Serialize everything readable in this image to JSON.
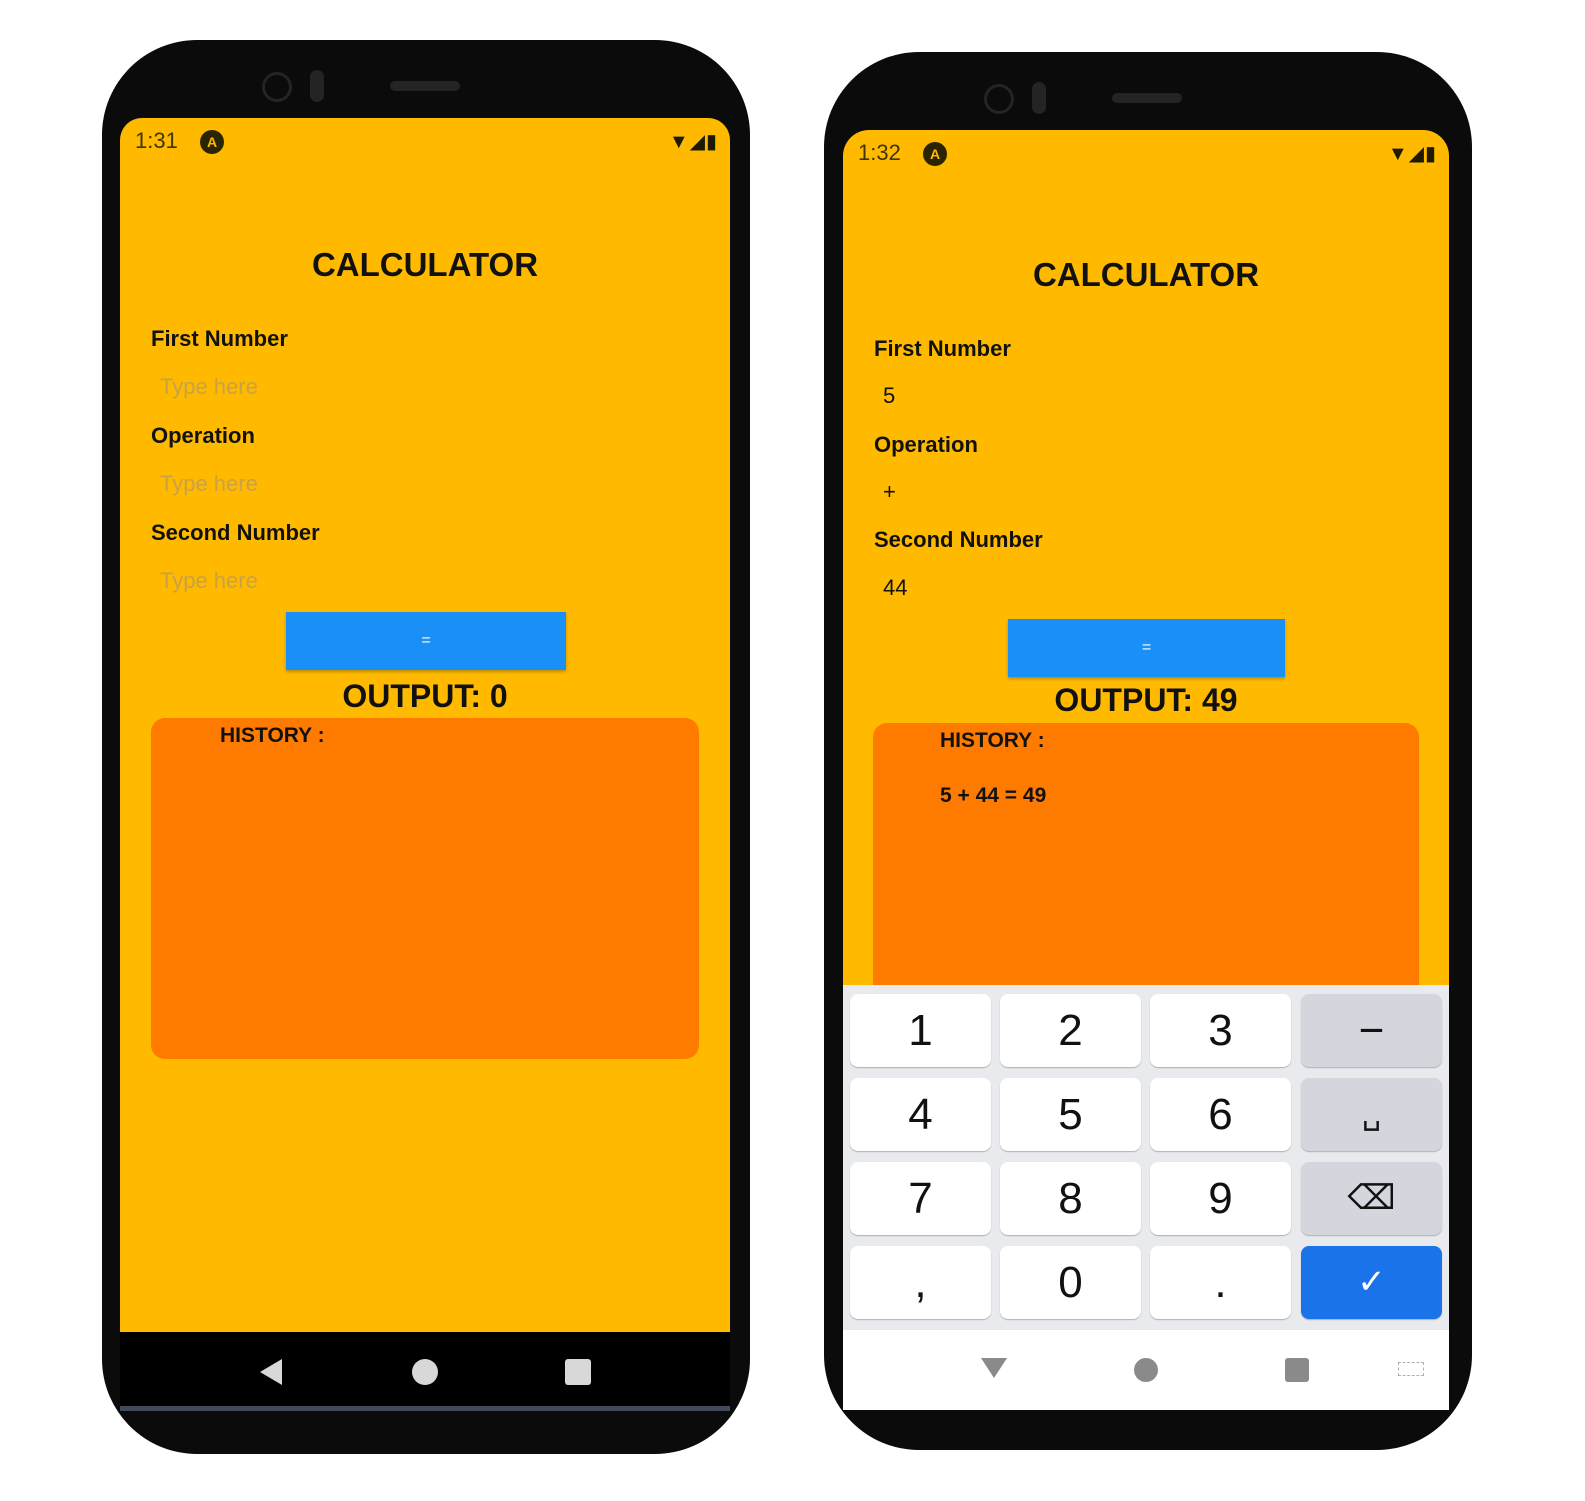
{
  "left": {
    "status": {
      "time": "1:31",
      "icons": "▼◢▮"
    },
    "title": "CALCULATOR",
    "first": {
      "label": "First Number",
      "placeholder": "Type here"
    },
    "op": {
      "label": "Operation",
      "placeholder": "Type here"
    },
    "second": {
      "label": "Second Number",
      "placeholder": "Type here"
    },
    "equals": "=",
    "output": "OUTPUT: 0",
    "history_title": "HISTORY :"
  },
  "right": {
    "status": {
      "time": "1:32",
      "icons": "▼◢▮"
    },
    "title": "CALCULATOR",
    "first": {
      "label": "First Number",
      "value": "5"
    },
    "op": {
      "label": "Operation",
      "value": "+"
    },
    "second": {
      "label": "Second Number",
      "value": "44"
    },
    "equals": "=",
    "output": "OUTPUT: 49",
    "history_title": "HISTORY :",
    "history_entry": "5 + 44 = 49",
    "keys": [
      "1",
      "2",
      "3",
      "−",
      "4",
      "5",
      "6",
      "␣",
      "7",
      "8",
      "9",
      "⌫",
      ",",
      "0",
      ".",
      "✓"
    ]
  },
  "colors": {
    "screen_bg": "#ffba00",
    "history_bg": "#ff7b00",
    "button": "#1a8ff5",
    "keyboard_done": "#1a73e8"
  }
}
